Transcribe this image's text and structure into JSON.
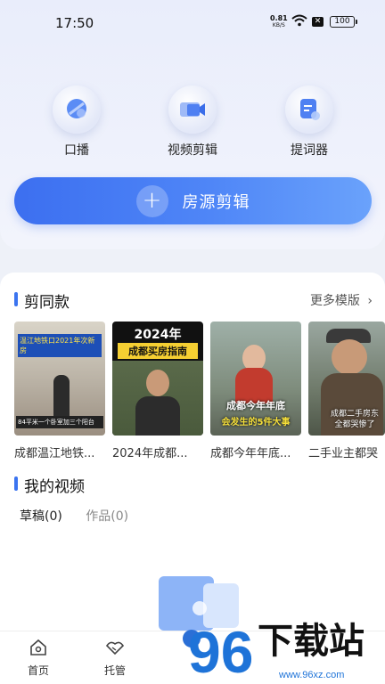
{
  "status_bar": {
    "time": "17:50",
    "net_speed": "0.81",
    "net_unit": "KB/S",
    "battery": "100"
  },
  "tools": [
    {
      "label": "口播",
      "icon": "microphone-icon"
    },
    {
      "label": "视频剪辑",
      "icon": "video-camera-icon"
    },
    {
      "label": "提词器",
      "icon": "prompter-icon"
    }
  ],
  "main_button": {
    "label": "房源剪辑",
    "icon": "plus-icon"
  },
  "templates_section": {
    "title": "剪同款",
    "more_label": "更多模版",
    "items": [
      {
        "caption": "成都温江地铁...",
        "overlay_top": "温江地铁口2021年次新房",
        "overlay_bottom": "84平米一个卧室加三个阳台"
      },
      {
        "caption": "2024年成都...",
        "overlay_top": "2024年",
        "overlay_sub": "成都买房指南"
      },
      {
        "caption": "成都今年年底...",
        "overlay_top": "成都今年年底",
        "overlay_bottom": "会发生的5件大事"
      },
      {
        "caption": "二手业主都哭",
        "overlay_top": "成都二手房东",
        "overlay_sub": "全都哭惨了"
      }
    ]
  },
  "videos_section": {
    "title": "我的视频",
    "tabs": [
      {
        "label": "草稿(0)"
      },
      {
        "label": "作品(0)"
      }
    ]
  },
  "bottom_nav": [
    {
      "label": "首页",
      "icon": "home-icon"
    },
    {
      "label": "托管",
      "icon": "handshake-icon"
    }
  ],
  "watermark": {
    "number": "96",
    "text": "下载站",
    "url": "www.96xz.com"
  },
  "colors": {
    "accent": "#3c6ff0",
    "background": "#eef1f8",
    "watermark_blue": "#1e73d8"
  }
}
